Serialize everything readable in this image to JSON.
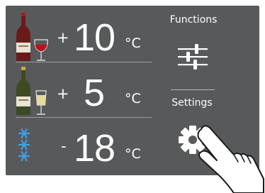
{
  "zones": [
    {
      "name": "red-wine",
      "sign": "+",
      "value": "10",
      "unit": "°C",
      "icon": "red-wine-bottle-glass-icon"
    },
    {
      "name": "white-wine",
      "sign": "+",
      "value": "5",
      "unit": "°C",
      "icon": "white-wine-bottle-glass-icon"
    },
    {
      "name": "freezer",
      "sign": "-",
      "value": "18",
      "unit": "°C",
      "icon": "snowflake-icon"
    }
  ],
  "sidebar": {
    "functions_label": "Functions",
    "functions_icon": "sliders-icon",
    "settings_label": "Settings",
    "settings_icon": "gear-icon"
  },
  "overlay": {
    "icon": "pointing-hand-icon"
  },
  "colors": {
    "panel": "#58595b",
    "text": "#ffffff",
    "divider": "#9a9b9d",
    "wine_red": "#b5141e",
    "wine_white": "#e8d9a0",
    "snowflake": "#3ea0e8"
  }
}
